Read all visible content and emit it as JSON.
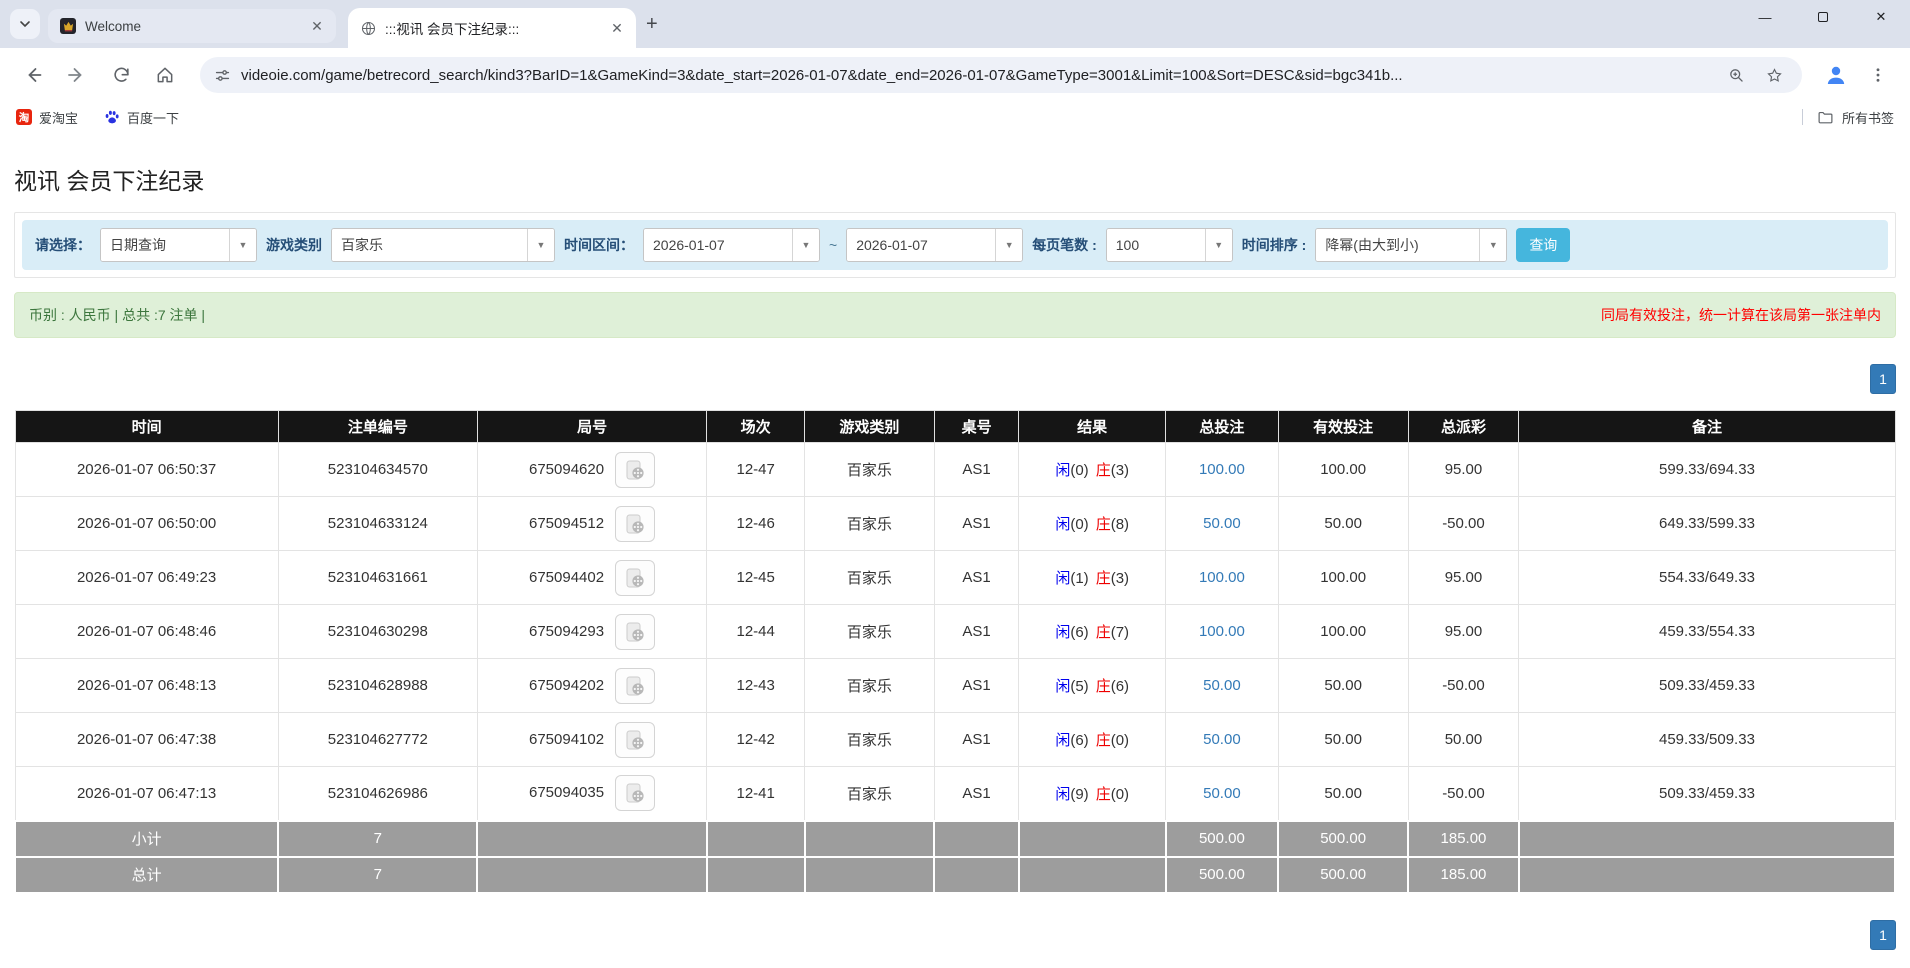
{
  "browser": {
    "tabs": [
      {
        "title": "Welcome"
      },
      {
        "title": ":::视讯 会员下注纪录:::"
      }
    ],
    "url": "videoie.com/game/betrecord_search/kind3?BarID=1&GameKind=3&date_start=2026-01-07&date_end=2026-01-07&GameType=3001&Limit=100&Sort=DESC&sid=bgc341b...",
    "bookmarks": [
      {
        "label": "爱淘宝",
        "icon": "taobao-icon",
        "icon_glyph": "淘"
      },
      {
        "label": "百度一下",
        "icon": "baidu-paw-icon"
      }
    ],
    "all_bookmarks_label": "所有书签"
  },
  "page": {
    "title": "视讯 会员下注纪录",
    "filter": {
      "select_label": "请选择：",
      "select_value": "日期查询",
      "game_kind_label": "游戏类别",
      "game_kind_value": "百家乐",
      "date_range_label": "时间区间：",
      "date_start": "2026-01-07",
      "date_separator": "~",
      "date_end": "2026-01-07",
      "page_size_label": "每页笔数 :",
      "page_size_value": "100",
      "sort_label": "时间排序 :",
      "sort_value": "降幂(由大到小)",
      "search_button": "查询"
    },
    "info_bar": {
      "summary": "币别 : 人民币 | 总共 :7 注单 |",
      "notice": "同局有效投注，统一计算在该局第一张注单内"
    },
    "pagination_label": "1",
    "table": {
      "headers": [
        "时间",
        "注单编号",
        "局号",
        "场次",
        "游戏类别",
        "桌号",
        "结果",
        "总投注",
        "有效投注",
        "总派彩",
        "备注"
      ],
      "rows": [
        {
          "time": "2026-01-07 06:50:37",
          "bet_id": "523104634570",
          "round": "675094620",
          "session": "12-47",
          "game": "百家乐",
          "table": "AS1",
          "player_label": "闲",
          "player_value": "(0)",
          "banker_label": "庄",
          "banker_value": "(3)",
          "total_bet": "100.00",
          "valid_bet": "100.00",
          "payout": "95.00",
          "remark": "599.33/694.33"
        },
        {
          "time": "2026-01-07 06:50:00",
          "bet_id": "523104633124",
          "round": "675094512",
          "session": "12-46",
          "game": "百家乐",
          "table": "AS1",
          "player_label": "闲",
          "player_value": "(0)",
          "banker_label": "庄",
          "banker_value": "(8)",
          "total_bet": "50.00",
          "valid_bet": "50.00",
          "payout": "-50.00",
          "remark": "649.33/599.33"
        },
        {
          "time": "2026-01-07 06:49:23",
          "bet_id": "523104631661",
          "round": "675094402",
          "session": "12-45",
          "game": "百家乐",
          "table": "AS1",
          "player_label": "闲",
          "player_value": "(1)",
          "banker_label": "庄",
          "banker_value": "(3)",
          "total_bet": "100.00",
          "valid_bet": "100.00",
          "payout": "95.00",
          "remark": "554.33/649.33"
        },
        {
          "time": "2026-01-07 06:48:46",
          "bet_id": "523104630298",
          "round": "675094293",
          "session": "12-44",
          "game": "百家乐",
          "table": "AS1",
          "player_label": "闲",
          "player_value": "(6)",
          "banker_label": "庄",
          "banker_value": "(7)",
          "total_bet": "100.00",
          "valid_bet": "100.00",
          "payout": "95.00",
          "remark": "459.33/554.33"
        },
        {
          "time": "2026-01-07 06:48:13",
          "bet_id": "523104628988",
          "round": "675094202",
          "session": "12-43",
          "game": "百家乐",
          "table": "AS1",
          "player_label": "闲",
          "player_value": "(5)",
          "banker_label": "庄",
          "banker_value": "(6)",
          "total_bet": "50.00",
          "valid_bet": "50.00",
          "payout": "-50.00",
          "remark": "509.33/459.33"
        },
        {
          "time": "2026-01-07 06:47:38",
          "bet_id": "523104627772",
          "round": "675094102",
          "session": "12-42",
          "game": "百家乐",
          "table": "AS1",
          "player_label": "闲",
          "player_value": "(6)",
          "banker_label": "庄",
          "banker_value": "(0)",
          "total_bet": "50.00",
          "valid_bet": "50.00",
          "payout": "50.00",
          "remark": "459.33/509.33"
        },
        {
          "time": "2026-01-07 06:47:13",
          "bet_id": "523104626986",
          "round": "675094035",
          "session": "12-41",
          "game": "百家乐",
          "table": "AS1",
          "player_label": "闲",
          "player_value": "(9)",
          "banker_label": "庄",
          "banker_value": "(0)",
          "total_bet": "50.00",
          "valid_bet": "50.00",
          "payout": "-50.00",
          "remark": "509.33/459.33"
        }
      ],
      "subtotal": {
        "label": "小计",
        "count": "7",
        "total_bet": "500.00",
        "valid_bet": "500.00",
        "payout": "185.00"
      },
      "total": {
        "label": "总计",
        "count": "7",
        "total_bet": "500.00",
        "valid_bet": "500.00",
        "payout": "185.00"
      }
    }
  },
  "colors": {
    "search_button": "#45b6dd",
    "pagination_blue": "#337ab7",
    "link_blue": "#337ab7",
    "negative_red": "#ff0000",
    "player_blue": "#0000ee",
    "banker_red": "#ee0000",
    "info_bar_bg": "#dff0d8",
    "info_text_green": "#3c763d",
    "table_header_bg": "#151515",
    "summary_row_bg": "#9d9d9d",
    "filter_bar_bg": "#d9edf7"
  }
}
